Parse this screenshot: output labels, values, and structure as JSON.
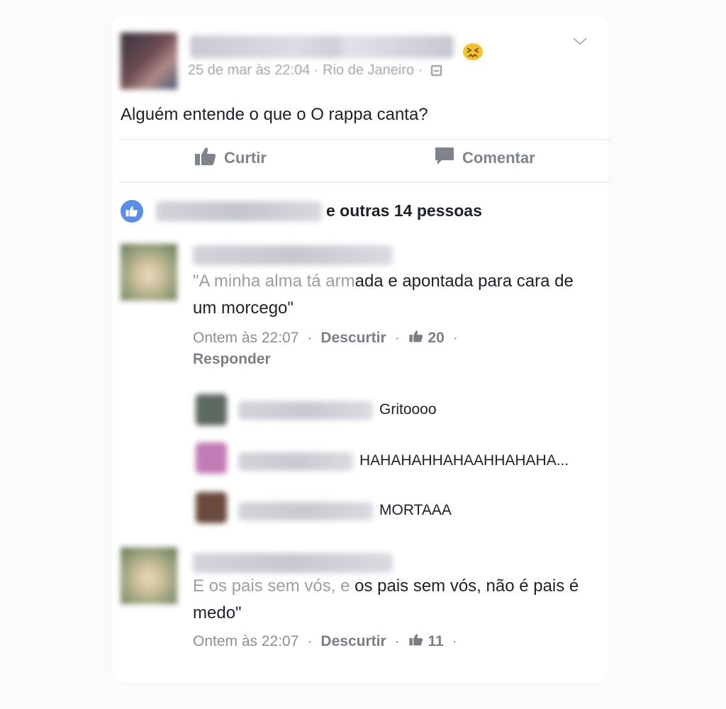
{
  "post": {
    "date": "25 de mar às 22:04",
    "separator": "·",
    "location": "Rio de Janeiro",
    "feeling_icon": "confounded-emoji",
    "text": "Alguém entende o que o O rappa canta?"
  },
  "actions": {
    "like_label": "Curtir",
    "comment_label": "Comentar"
  },
  "likes": {
    "text": "e outras 14 pessoas"
  },
  "comments": [
    {
      "text_faded": "\"A minha alma tá arm",
      "text": "ada e apontada para cara de um morcego\"",
      "time": "Ontem às 22:07",
      "unlike_label": "Descurtir",
      "like_count": "20",
      "reply_label": "Responder",
      "replies": [
        {
          "text": "Gritoooo"
        },
        {
          "text": "HAHAHAHHAHAAHHAHAHA..."
        },
        {
          "text": "MORTAAA"
        }
      ]
    },
    {
      "text_faded": "E os pais sem vós, e",
      "text": " os pais sem vós, não é pais é medo\"",
      "time": "Ontem às 22:07",
      "unlike_label": "Descurtir",
      "like_count": "11"
    }
  ],
  "colors": {
    "link_blue": "#5b8ee8",
    "meta_gray": "#8a8f97",
    "text_dark": "#1d2129"
  }
}
